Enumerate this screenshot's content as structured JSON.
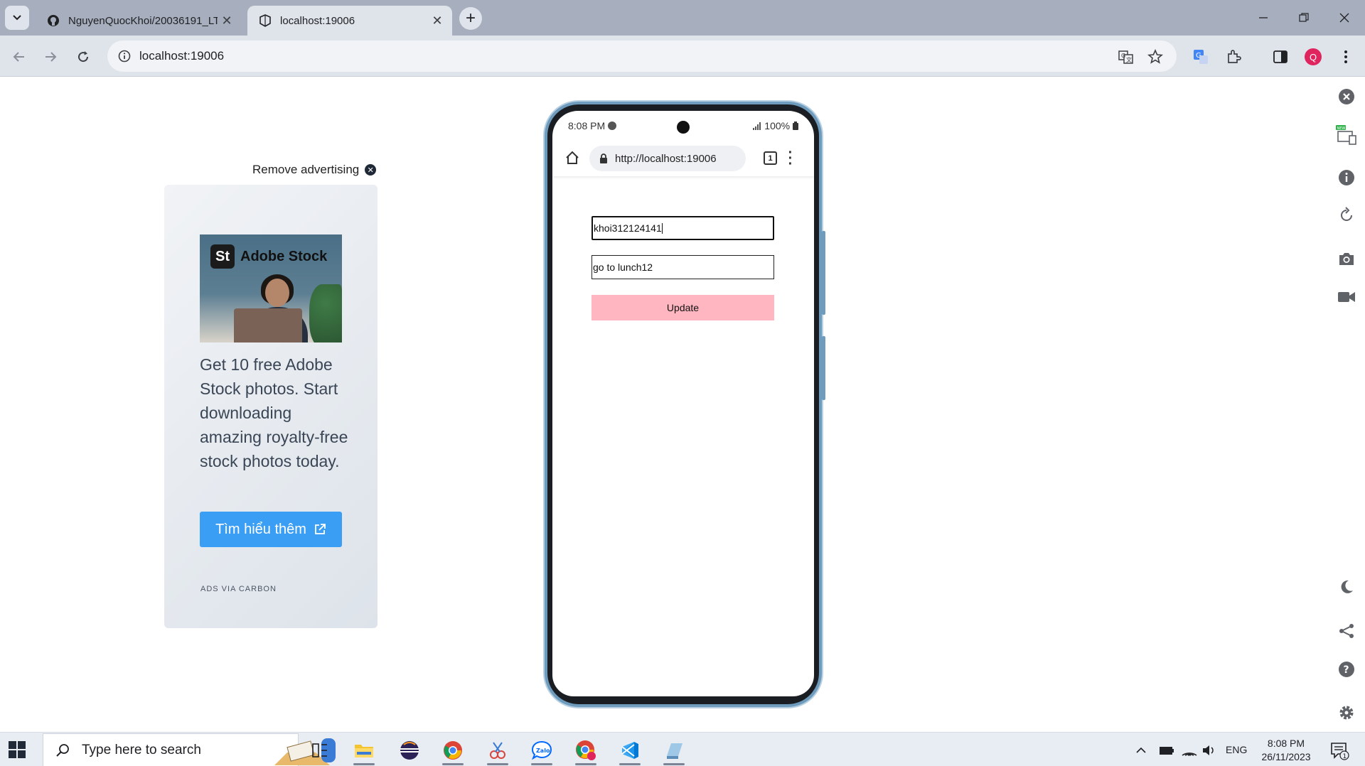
{
  "browser": {
    "tabs": [
      {
        "title": "NguyenQuocKhoi/20036191_LT",
        "icon": "github-icon",
        "active": false
      },
      {
        "title": "localhost:19006",
        "icon": "expo-icon",
        "active": true
      }
    ],
    "address": "localhost:19006",
    "profile_initial": "Q"
  },
  "ad": {
    "remove_label": "Remove advertising",
    "image_brand": "Adobe Stock",
    "image_brand_badge": "St",
    "text": "Get 10 free Adobe Stock photos. Start downloading amazing royalty-free stock photos today.",
    "button_label": "Tìm hiểu thêm",
    "via": "ADS VIA CARBON"
  },
  "phone": {
    "status_time": "8:08 PM",
    "battery": "100%",
    "url": "http://localhost:19006",
    "tab_count": "1",
    "form": {
      "field1_value": "khoi312124141",
      "field2_value": "go to lunch12",
      "button_label": "Update"
    }
  },
  "taskbar": {
    "search_placeholder": "Type here to search",
    "language": "ENG",
    "time": "8:08 PM",
    "date": "26/11/2023",
    "notification_count": "1"
  },
  "colors": {
    "tabbar_bg": "#a7aebd",
    "toolbar_bg": "#dfe3ea",
    "ad_button": "#3b9ef5",
    "update_button": "#ffb6c1",
    "phone_frame": "#6f9bbd"
  }
}
